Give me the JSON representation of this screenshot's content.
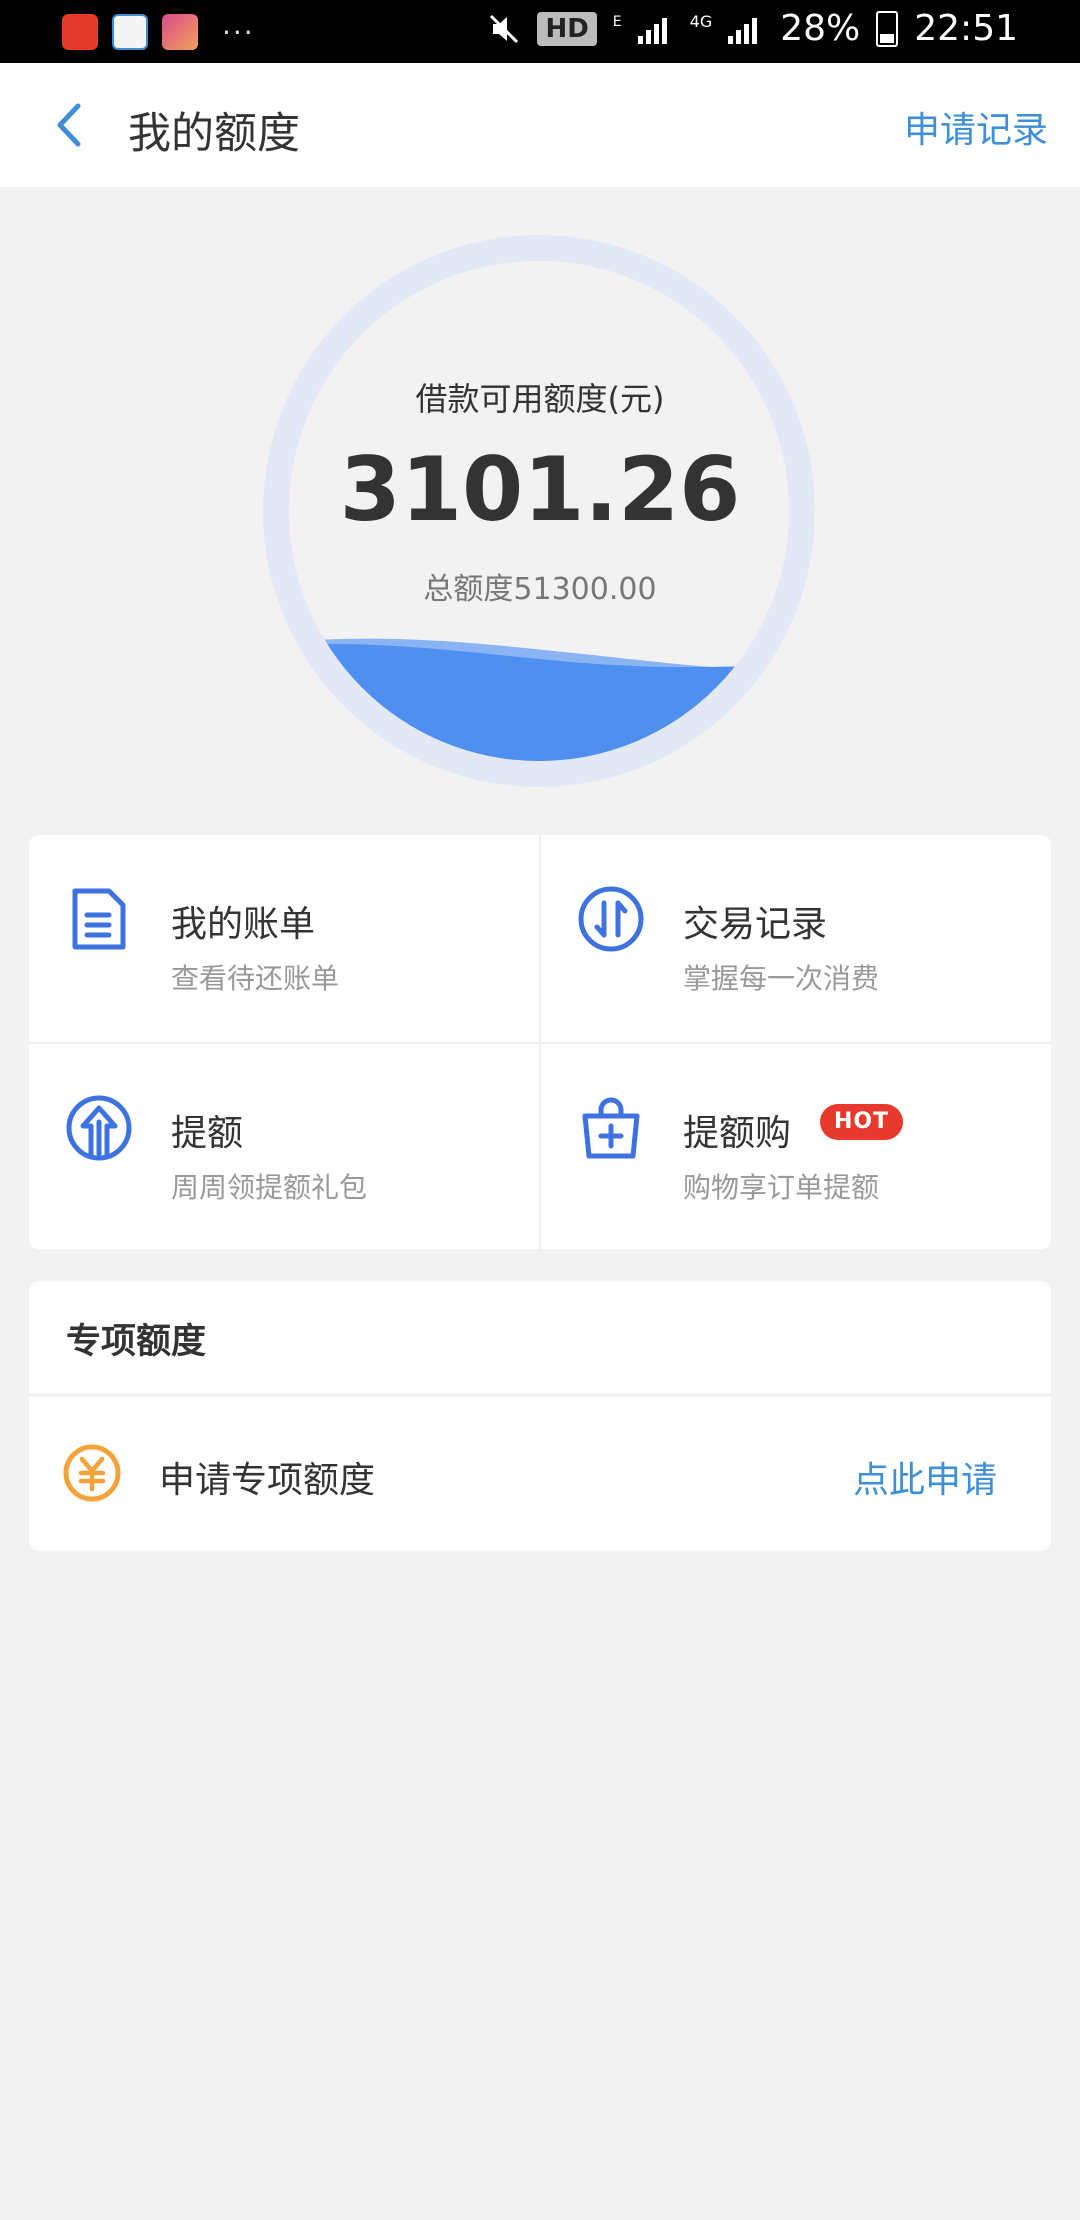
{
  "status_bar": {
    "battery": "28%",
    "time": "22:51",
    "hd": "HD",
    "network_e": "E",
    "network_4g": "4G",
    "dots": "···"
  },
  "header": {
    "title": "我的额度",
    "right_action": "申请记录"
  },
  "credit": {
    "available_label": "借款可用额度(元)",
    "available_amount": "3101.26",
    "total_label": "总额度51300.00",
    "available_fraction": 0.0605
  },
  "grid": [
    {
      "title": "我的账单",
      "subtitle": "查看待还账单",
      "icon": "bill-icon"
    },
    {
      "title": "交易记录",
      "subtitle": "掌握每一次消费",
      "icon": "transaction-icon"
    },
    {
      "title": "提额",
      "subtitle": "周周领提额礼包",
      "icon": "raise-limit-icon"
    },
    {
      "title": "提额购",
      "subtitle": "购物享订单提额",
      "icon": "shopping-bag-icon",
      "badge": "HOT"
    }
  ],
  "special": {
    "title": "专项额度",
    "row_label": "申请专项额度",
    "row_action": "点此申请"
  },
  "colors": {
    "accent_blue": "#3e8fd8",
    "icon_blue": "#3d72e0",
    "wave_blue": "#4f8ff0",
    "ring": "#e3e8f7",
    "hot_red": "#e8392f",
    "coin_orange": "#f2a33a"
  }
}
